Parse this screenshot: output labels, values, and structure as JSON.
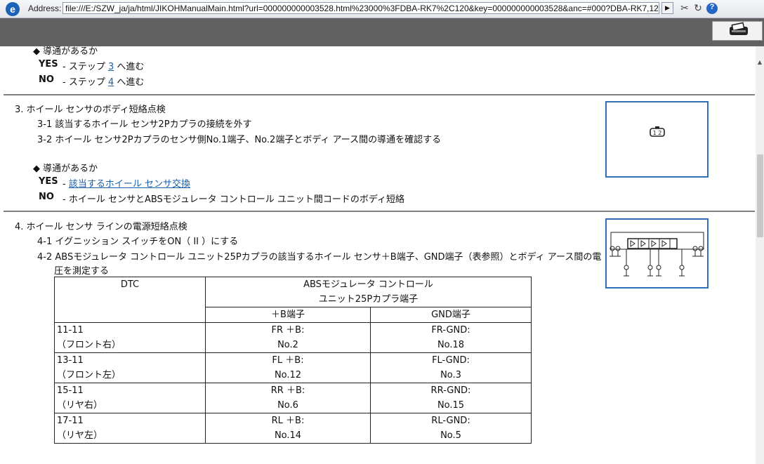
{
  "browser": {
    "address_label": "Address:",
    "url": "file:///E:/SZW_ja/ja/html/JIKOHManualMain.html?url=000000000003528.html%23000%3FDBA-RK7%2C120&key=000000000003528&anc=#000?DBA-RK7,12("
  },
  "top_section": {
    "continuity_q": "◆ 導通があるか",
    "yes_label": "YES",
    "yes_pre": "- ステップ ",
    "yes_step": "3",
    "yes_post": " へ進む",
    "no_label": "NO",
    "no_pre": "- ステップ ",
    "no_step": "4",
    "no_post": " へ進む"
  },
  "step3": {
    "title": "3.   ホイール センサのボディ短絡点検",
    "sub1": "3-1 該当するホイール センサ2Pカプラの接続を外す",
    "sub2": "3-2 ホイール センサ2Pカプラのセンサ側No.1端子、No.2端子とボディ アース間の導通を確認する",
    "continuity_q": "◆ 導通があるか",
    "yes_label": "YES",
    "yes_dash": "- ",
    "yes_link": "該当するホイール センサ交換",
    "no_label": "NO",
    "no_text": "- ホイール センサとABSモジュレータ コントロール ユニット間コードのボディ短絡"
  },
  "step4": {
    "title": "4.   ホイール センサ ラインの電源短絡点検",
    "sub1": "4-1 イグニッション スイッチをON（ II ）にする",
    "sub2_line1": "4-2 ABSモジュレータ コントロール ユニット25Pカプラの該当するホイール センサ＋B端子、GND端子（表参照）とボディ アース間の電",
    "sub2_line2": "圧を測定する"
  },
  "table": {
    "h_dtc": "DTC",
    "h_unit_1": "ABSモジュレータ コントロール",
    "h_unit_2": "ユニット25Pカプラ端子",
    "h_b": "＋B端子",
    "h_gnd": "GND端子",
    "rows": [
      {
        "code": "11-11",
        "pos": "（フロント右）",
        "b1": "FR ＋B:",
        "b2": "No.2",
        "g1": "FR-GND:",
        "g2": "No.18"
      },
      {
        "code": "13-11",
        "pos": "（フロント左）",
        "b1": "FL ＋B:",
        "b2": "No.12",
        "g1": "FL-GND:",
        "g2": "No.3"
      },
      {
        "code": "15-11",
        "pos": "（リヤ右）",
        "b1": "RR ＋B:",
        "b2": "No.6",
        "g1": "RR-GND:",
        "g2": "No.15"
      },
      {
        "code": "17-11",
        "pos": "（リヤ左）",
        "b1": "RL ＋B:",
        "b2": "No.14",
        "g1": "RL-GND:",
        "g2": "No.5"
      }
    ]
  },
  "figures": {
    "connector_label": "1 2"
  },
  "colors": {
    "link": "#1a5ea8",
    "figure_border": "#2f6fb3",
    "toolbar_gray": "#616161"
  }
}
